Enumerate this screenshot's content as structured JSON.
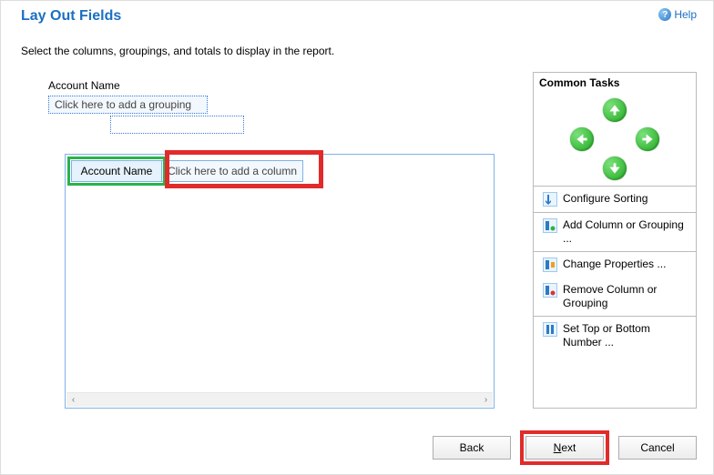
{
  "header": {
    "title": "Lay Out Fields",
    "help_label": "Help"
  },
  "instruction": "Select the columns, groupings, and totals to display in the report.",
  "grouping": {
    "field_label": "Account Name",
    "add_grouping_placeholder": "Click here to add a grouping"
  },
  "columns": {
    "first_column": "Account Name",
    "add_column_placeholder": "Click here to add a column"
  },
  "tasks_panel": {
    "title": "Common Tasks",
    "items": [
      "Configure Sorting",
      "Add Column or Grouping ...",
      "Change Properties ...",
      "Remove Column or Grouping",
      "Set Top or Bottom Number ..."
    ]
  },
  "footer": {
    "back": "Back",
    "next_prefix": "N",
    "next_rest": "ext",
    "cancel": "Cancel"
  }
}
